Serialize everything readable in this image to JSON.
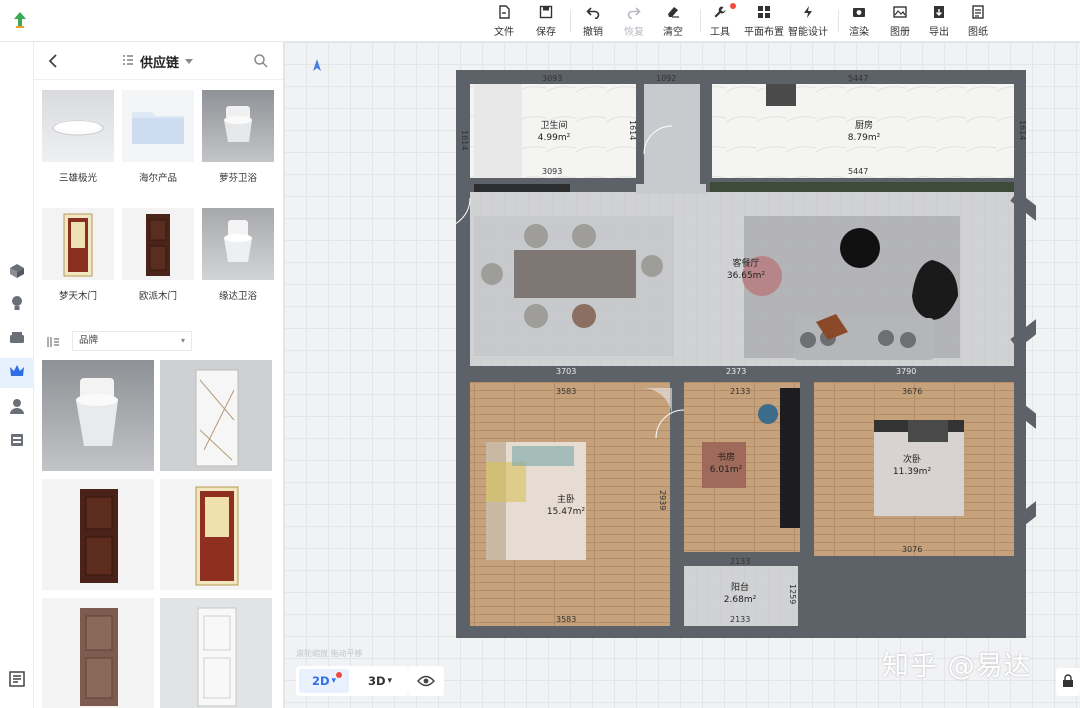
{
  "toolbar": {
    "items": [
      {
        "label": "文件",
        "icon": "file-icon"
      },
      {
        "label": "保存",
        "icon": "save-icon"
      },
      {
        "label": "撤销",
        "icon": "undo-icon"
      },
      {
        "label": "恢复",
        "icon": "redo-icon"
      },
      {
        "label": "清空",
        "icon": "eraser-icon"
      },
      {
        "label": "工具",
        "icon": "wrench-icon"
      },
      {
        "label": "平面布置",
        "icon": "layout-icon"
      },
      {
        "label": "智能设计",
        "icon": "lightning-icon"
      },
      {
        "label": "渲染",
        "icon": "camera-icon"
      },
      {
        "label": "图册",
        "icon": "album-icon"
      },
      {
        "label": "导出",
        "icon": "export-icon"
      },
      {
        "label": "图纸",
        "icon": "drawing-icon"
      }
    ]
  },
  "panel": {
    "category": "供应链",
    "filter": "品牌",
    "products": [
      {
        "label": "三雄极光"
      },
      {
        "label": "海尔产品"
      },
      {
        "label": "萝芬卫浴"
      },
      {
        "label": "梦天木门"
      },
      {
        "label": "欧派木门"
      },
      {
        "label": "缘达卫浴"
      }
    ]
  },
  "canvas": {
    "view_2d": "2D",
    "view_3d": "3D",
    "hint": "滚轮缩放 拖动平移",
    "watermark": "知乎 @易达"
  },
  "plan": {
    "rooms": [
      {
        "name": "卫生间",
        "area": "4.99m²"
      },
      {
        "name": "厨房",
        "area": "8.79m²"
      },
      {
        "name": "客餐厅",
        "area": "36.65m²"
      },
      {
        "name": "主卧",
        "area": "15.47m²"
      },
      {
        "name": "书房",
        "area": "6.01m²"
      },
      {
        "name": "次卧",
        "area": "11.39m²"
      },
      {
        "name": "阳台",
        "area": "2.68m²"
      }
    ],
    "dims": [
      "3093",
      "1092",
      "5447",
      "1614",
      "1614",
      "1614",
      "3093",
      "5447",
      "3703",
      "2373",
      "3790",
      "3583",
      "2133",
      "3676",
      "2939",
      "3583",
      "2133",
      "2133",
      "1259",
      "3076"
    ]
  },
  "colors": {
    "accent": "#2e6fe8",
    "wall": "#5d6168",
    "floor_tile": "#c9cacd",
    "floor_wood": "#c4a07a"
  }
}
